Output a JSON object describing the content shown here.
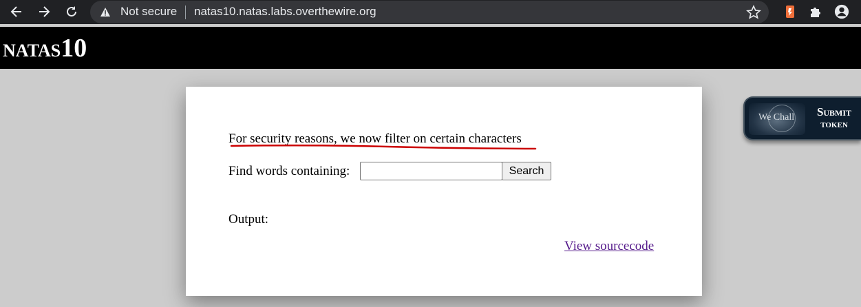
{
  "browser": {
    "security_label": "Not secure",
    "url": "natas10.natas.labs.overthewire.org"
  },
  "natas_header": {
    "title_prefix": "NATAS",
    "title_number": "10"
  },
  "content": {
    "intro": "For security reasons, we now filter on certain characters",
    "find_label": "Find words containing:",
    "needle_value": "",
    "search_button": "Search",
    "output_label": "Output:",
    "source_link": "View sourcecode"
  },
  "wechall": {
    "logo_text": "We Chall",
    "line1": "Submit",
    "line2": "token"
  },
  "colors": {
    "page_bg": "#cccccc",
    "header_bg": "#000000",
    "chrome_bg": "#202124",
    "link_visited": "#551a8b",
    "underline_red": "#cc0000"
  }
}
